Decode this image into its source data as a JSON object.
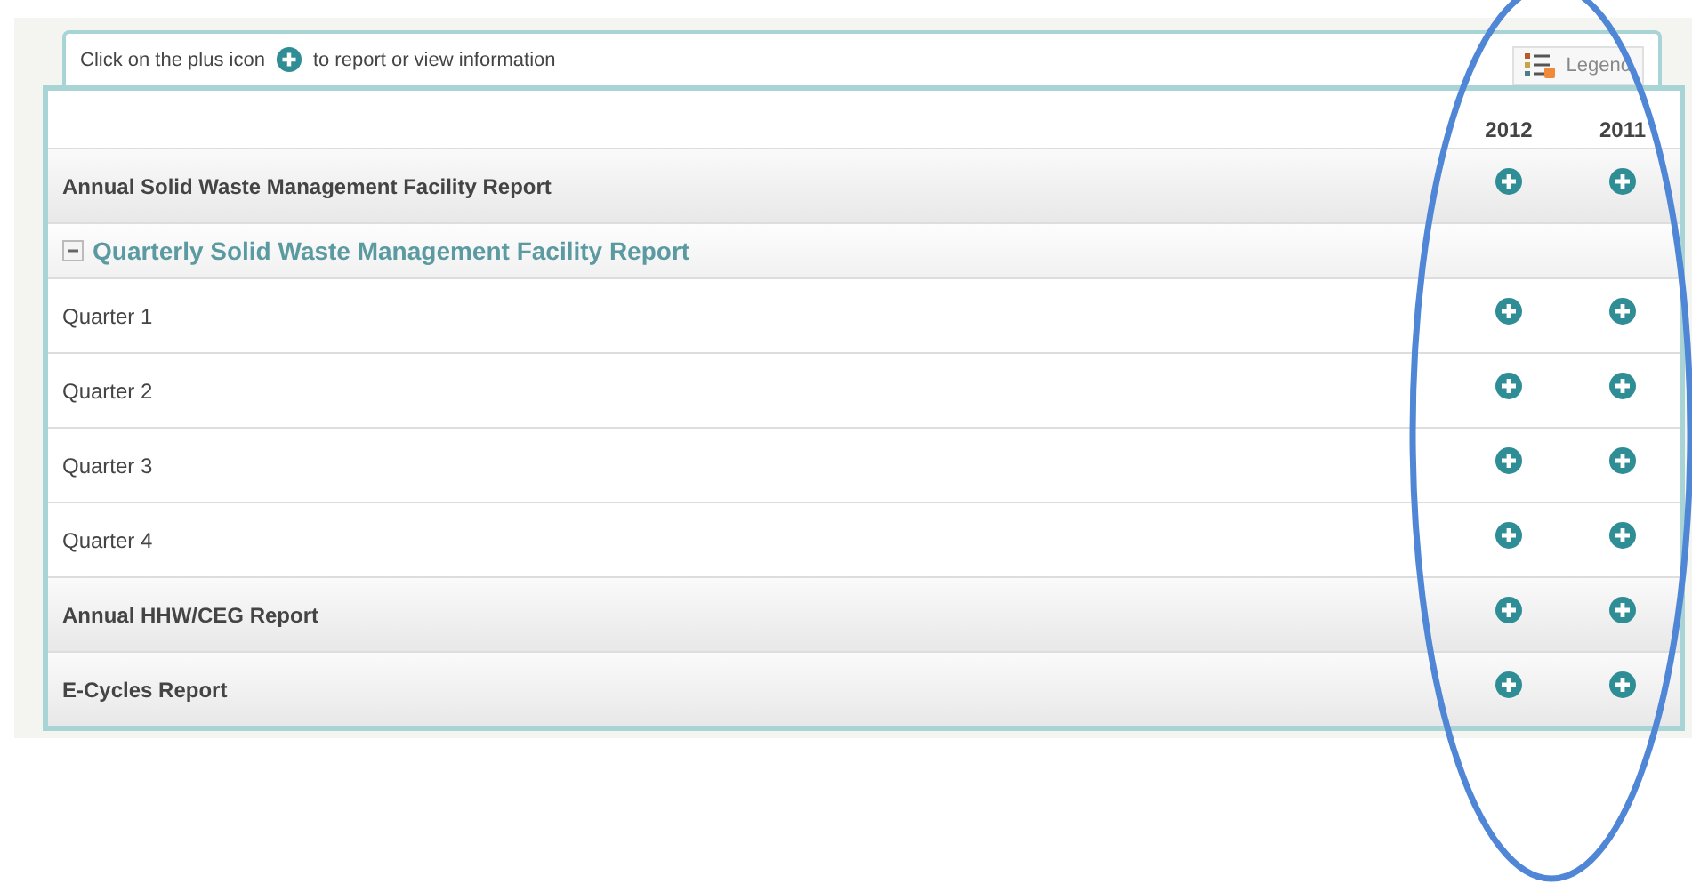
{
  "instruction": {
    "before": "Click on the plus icon",
    "after": "to report or view information"
  },
  "legend": {
    "label": "Legend"
  },
  "columns": [
    "2012",
    "2011"
  ],
  "rows": [
    {
      "kind": "report",
      "label": "Annual Solid Waste Management Facility Report"
    },
    {
      "kind": "group",
      "label": "Quarterly Solid Waste Management Facility Report",
      "expanded": true,
      "children": [
        {
          "kind": "item",
          "label": "Quarter 1"
        },
        {
          "kind": "item",
          "label": "Quarter 2"
        },
        {
          "kind": "item",
          "label": "Quarter 3"
        },
        {
          "kind": "item",
          "label": "Quarter 4"
        }
      ]
    },
    {
      "kind": "report",
      "label": "Annual HHW/CEG Report"
    },
    {
      "kind": "report",
      "label": "E-Cycles Report"
    }
  ]
}
